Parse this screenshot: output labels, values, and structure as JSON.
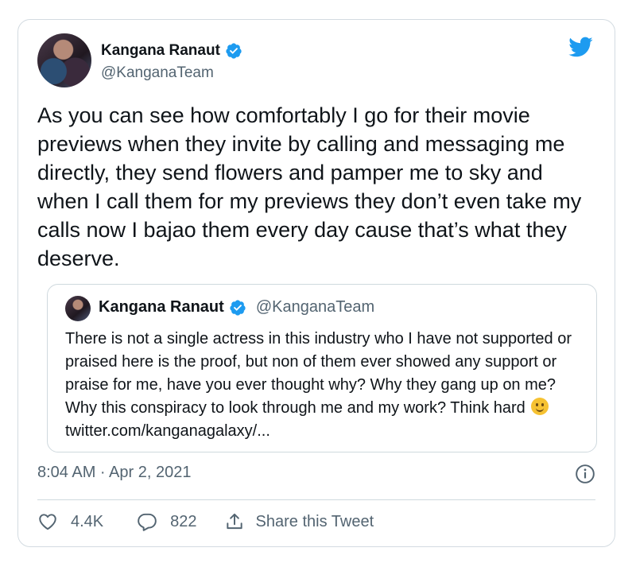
{
  "author": {
    "name": "Kangana Ranaut",
    "handle": "@KanganaTeam"
  },
  "tweet": {
    "text": "As you can see how comfortably I go for their movie previews when they invite by calling and messaging me directly, they send flowers and pamper me to sky and when I call them for my previews they don’t even take my calls now I bajao them every day cause that’s what they deserve.",
    "timestamp": "8:04 AM · Apr 2, 2021"
  },
  "quoted": {
    "name": "Kangana Ranaut",
    "handle": "@KanganaTeam",
    "text_before_emoji": "There is not a single actress in this industry who I have not supported or praised here is the proof, but non of them ever showed any support or praise for me, have you ever thought why? Why they gang up on me? Why this conspiracy to look through me and my work? Think hard",
    "link": "twitter.com/kanganagalaxy/..."
  },
  "actions": {
    "likes": "4.4K",
    "replies": "822",
    "share_label": "Share this Tweet"
  },
  "colors": {
    "accent": "#1d9bf0",
    "secondary_text": "#536471",
    "border": "#cfd9de"
  },
  "icons": [
    "twitter-bird-icon",
    "verified-badge-icon",
    "info-icon",
    "heart-icon",
    "reply-icon",
    "share-icon",
    "smiley-emoji"
  ]
}
